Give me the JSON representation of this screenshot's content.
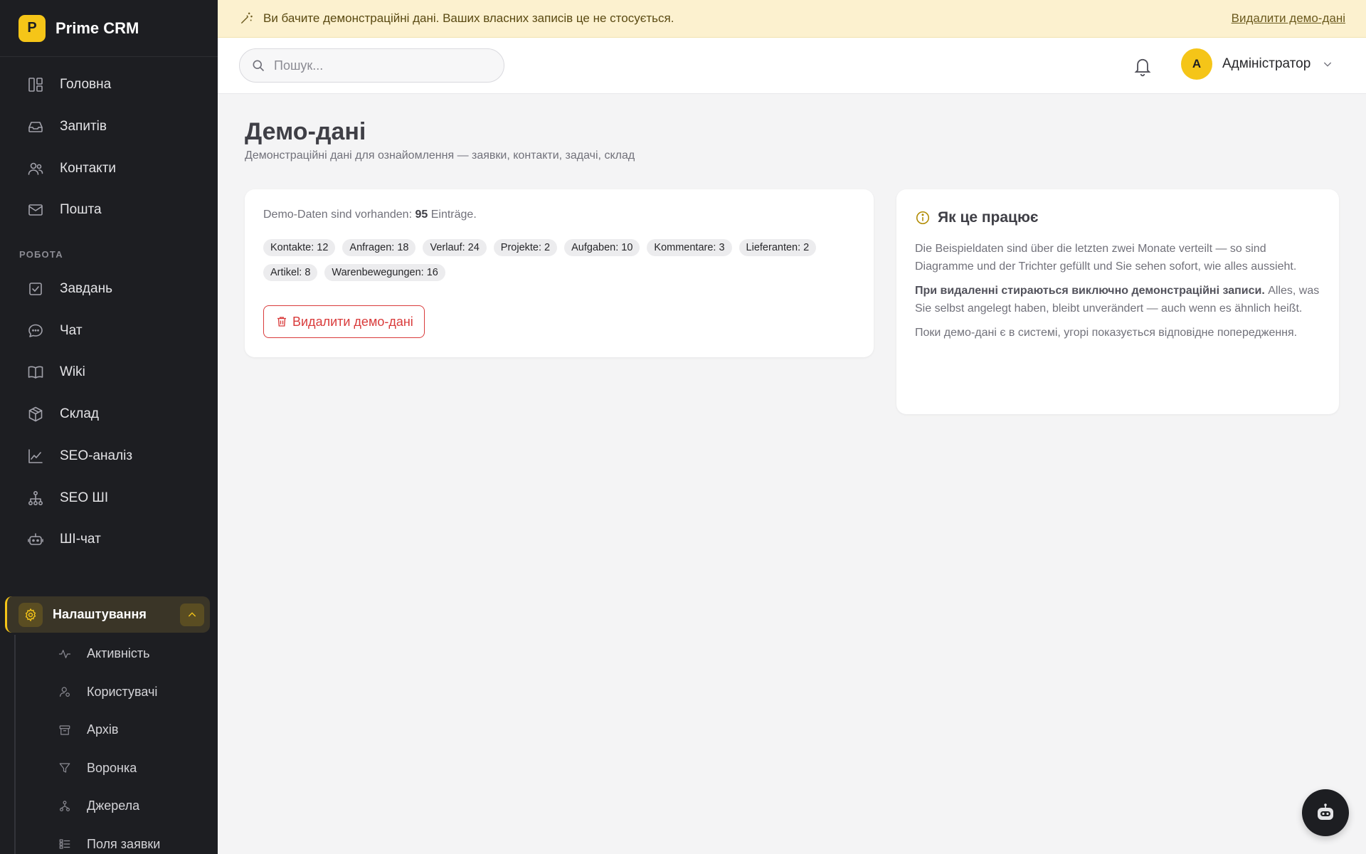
{
  "brand": {
    "logo_letter": "P",
    "name": "Prime CRM",
    "accent": "#f5c518"
  },
  "sidebar": {
    "items": [
      {
        "label": "Головна",
        "icon": "dashboard-icon"
      },
      {
        "label": "Запитів",
        "icon": "inbox-icon"
      },
      {
        "label": "Контакти",
        "icon": "users-icon"
      },
      {
        "label": "Пошта",
        "icon": "mail-icon"
      }
    ],
    "section_label": "РОБОТА",
    "work_items": [
      {
        "label": "Завдань",
        "icon": "checkbox-icon"
      },
      {
        "label": "Чат",
        "icon": "chat-icon"
      },
      {
        "label": "Wiki",
        "icon": "book-icon"
      },
      {
        "label": "Склад",
        "icon": "box-icon"
      },
      {
        "label": "SEO-аналіз",
        "icon": "chart-icon"
      },
      {
        "label": "SEO ШІ",
        "icon": "hierarchy-icon"
      },
      {
        "label": "ШІ-чат",
        "icon": "robot-icon"
      }
    ],
    "settings_label": "Налаштування",
    "sub_items": [
      {
        "label": "Активність",
        "icon": "activity-icon"
      },
      {
        "label": "Користувачі",
        "icon": "user-icon"
      },
      {
        "label": "Архів",
        "icon": "archive-icon"
      },
      {
        "label": "Воронка",
        "icon": "funnel-icon"
      },
      {
        "label": "Джерела",
        "icon": "sources-icon"
      },
      {
        "label": "Поля заявки",
        "icon": "fields-icon"
      }
    ]
  },
  "banner": {
    "text": "Ви бачите демонстраційні дані. Ваших власних записів це не стосується.",
    "link": "Видалити демо-дані"
  },
  "topbar": {
    "search_placeholder": "Пошук...",
    "user_initial": "A",
    "user_name": "Адміністратор"
  },
  "page": {
    "title": "Демо-дані",
    "subtitle": "Демонстраційні дані для ознайомлення — заявки, контакти, задачі, склад"
  },
  "summary": {
    "prefix": "Demo-Daten sind vorhanden:",
    "count": "95",
    "suffix": "Einträge.",
    "tags": [
      "Kontakte: 12",
      "Anfragen: 18",
      "Verlauf: 24",
      "Projekte: 2",
      "Aufgaben: 10",
      "Kommentare: 3",
      "Lieferanten: 2",
      "Artikel: 8",
      "Warenbewegungen: 16"
    ],
    "delete_button": "Видалити демо-дані"
  },
  "info": {
    "title": "Як це працює",
    "p1": "Die Beispieldaten sind über die letzten zwei Monate verteilt — so sind Diagramme und der Trichter gefüllt und Sie sehen sofort, wie alles aussieht.",
    "p2_bold": "При видаленні стираються виключно демонстраційні записи.",
    "p2_rest": " Alles, was Sie selbst angelegt haben, bleibt unverändert — auch wenn es ähnlich heißt.",
    "p3": "Поки демо-дані є в системі, угорі показується відповідне попередження."
  }
}
